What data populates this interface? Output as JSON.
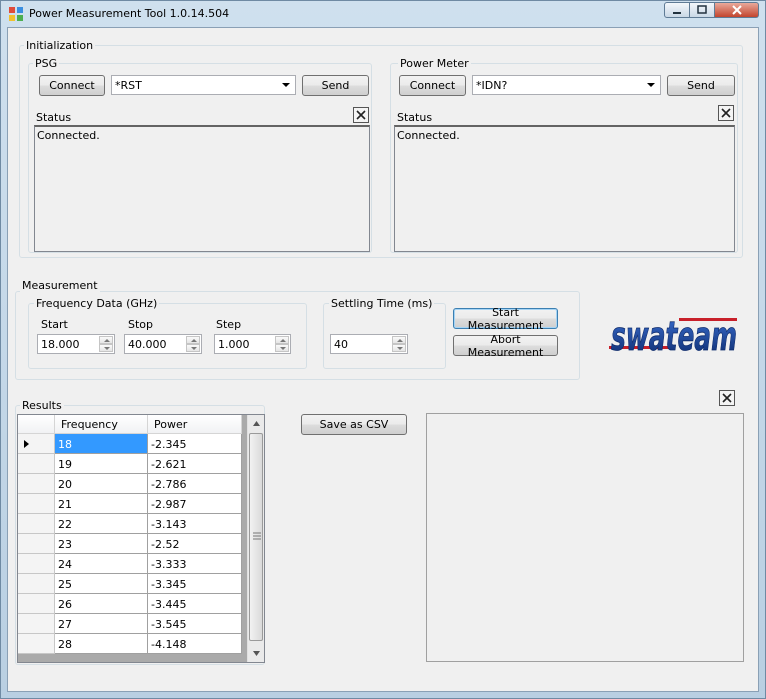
{
  "window": {
    "title": "Power Measurement Tool 1.0.14.504"
  },
  "initialization": {
    "label": "Initialization",
    "psg": {
      "label": "PSG",
      "connect_label": "Connect",
      "command": "*RST",
      "send_label": "Send",
      "status_label": "Status",
      "status_text": "Connected."
    },
    "power_meter": {
      "label": "Power Meter",
      "connect_label": "Connect",
      "command": "*IDN?",
      "send_label": "Send",
      "status_label": "Status",
      "status_text": "Connected."
    }
  },
  "measurement": {
    "label": "Measurement",
    "frequency": {
      "label": "Frequency Data (GHz)",
      "start_label": "Start",
      "start_value": "18.000",
      "stop_label": "Stop",
      "stop_value": "40.000",
      "step_label": "Step",
      "step_value": "1.000"
    },
    "settling": {
      "label": "Settling Time (ms)",
      "value": "40"
    },
    "start_button": "Start Measurement",
    "abort_button": "Abort Measurement",
    "logo_text": "swateam"
  },
  "results": {
    "label": "Results",
    "columns": [
      "Frequency",
      "Power"
    ],
    "rows": [
      [
        "18",
        "-2.345"
      ],
      [
        "19",
        "-2.621"
      ],
      [
        "20",
        "-2.786"
      ],
      [
        "21",
        "-2.987"
      ],
      [
        "22",
        "-3.143"
      ],
      [
        "23",
        "-2.52"
      ],
      [
        "24",
        "-3.333"
      ],
      [
        "25",
        "-3.345"
      ],
      [
        "26",
        "-3.445"
      ],
      [
        "27",
        "-3.545"
      ],
      [
        "28",
        "-4.148"
      ]
    ],
    "save_label": "Save as CSV"
  },
  "colors": {
    "logo_blue": "#1a3f8f",
    "logo_red": "#c8202a",
    "selection": "#3399ff"
  },
  "icons": {
    "close_small": "close-icon",
    "row_pointer": "triangle-right-icon"
  }
}
